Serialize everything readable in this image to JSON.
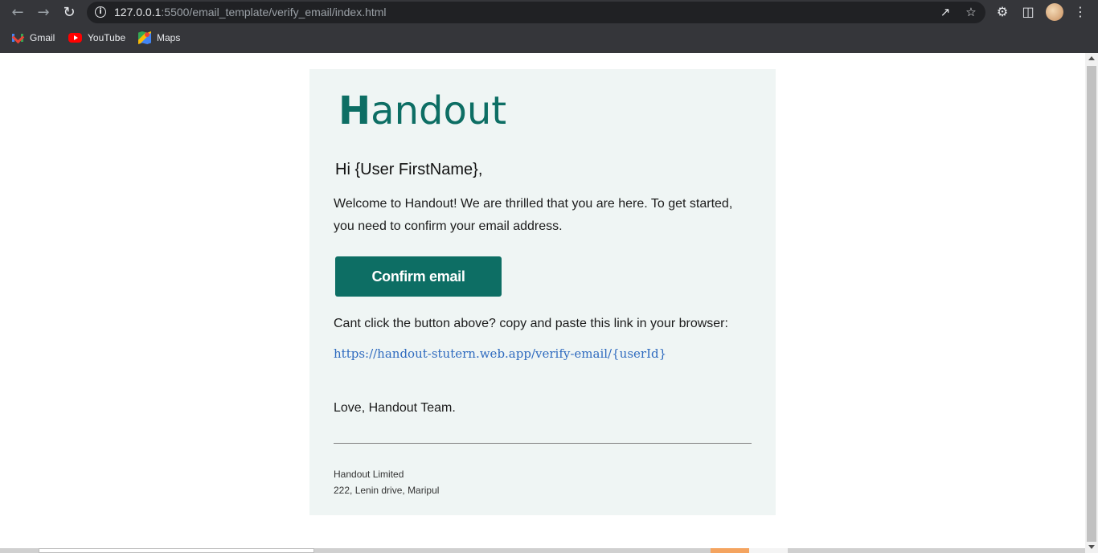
{
  "browser": {
    "url_host": "127.0.0.1",
    "url_rest": ":5500/email_template/verify_email/index.html",
    "icons": {
      "back": "arrow-left-icon",
      "forward": "arrow-right-icon",
      "reload": "reload-icon",
      "info": "info-icon",
      "share": "share-icon",
      "bookmark": "star-icon",
      "extensions": "puzzle-icon",
      "sidepanel": "side-panel-icon",
      "menu": "kebab-menu-icon"
    },
    "bookmarks": [
      {
        "label": "Gmail",
        "icon": "gmail-icon"
      },
      {
        "label": "YouTube",
        "icon": "youtube-icon"
      },
      {
        "label": "Maps",
        "icon": "maps-icon"
      }
    ]
  },
  "email": {
    "logo_text_h": "H",
    "logo_text_rest": "andout",
    "greeting": "Hi {User FirstName},",
    "intro": "Welcome to Handout! We are thrilled that you are here. To get started, you need to confirm your email address.",
    "confirm_button": "Confirm email",
    "fallback_text": "Cant click the button above? copy and paste this link in your browser:",
    "verify_link": "https://handout-stutern.web.app/verify-email/{userId}",
    "signoff": "Love, Handout Team.",
    "footer": {
      "company": "Handout Limited",
      "address": "222, Lenin drive, Maripul"
    }
  },
  "colors": {
    "brand": "#0d6e64",
    "card_background": "#eff5f4",
    "link": "#2f6bbf"
  }
}
